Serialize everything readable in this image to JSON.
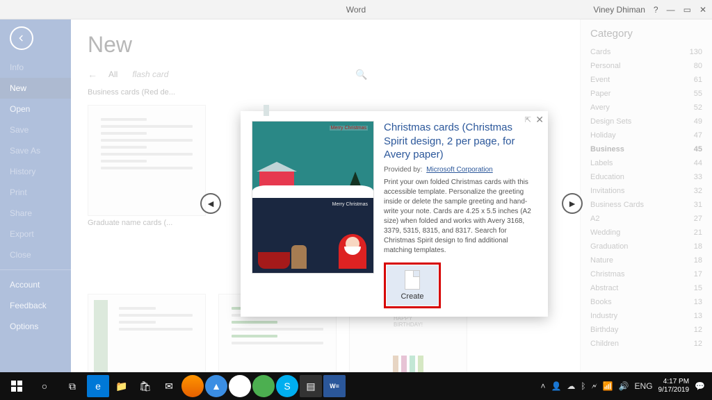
{
  "titlebar": {
    "app": "Word",
    "user": "Viney Dhiman"
  },
  "file_menu": {
    "items": [
      {
        "label": "Info",
        "state": "disabled"
      },
      {
        "label": "New",
        "state": "active"
      },
      {
        "label": "Open",
        "state": "normal"
      },
      {
        "label": "Save",
        "state": "disabled"
      },
      {
        "label": "Save As",
        "state": "disabled"
      },
      {
        "label": "History",
        "state": "disabled"
      },
      {
        "label": "Print",
        "state": "disabled"
      },
      {
        "label": "Share",
        "state": "disabled"
      },
      {
        "label": "Export",
        "state": "disabled"
      },
      {
        "label": "Close",
        "state": "disabled"
      }
    ],
    "footer": [
      {
        "label": "Account"
      },
      {
        "label": "Feedback"
      },
      {
        "label": "Options"
      }
    ]
  },
  "main": {
    "heading": "New",
    "filter_all": "All",
    "search_placeholder": "flash card",
    "templates": [
      {
        "caption": "Business cards (Red de..."
      },
      {
        "caption": "Graduate name cards (..."
      }
    ]
  },
  "categories": [
    {
      "name": "Cards",
      "count": 130
    },
    {
      "name": "Personal",
      "count": 80
    },
    {
      "name": "Event",
      "count": 61
    },
    {
      "name": "Paper",
      "count": 55
    },
    {
      "name": "Avery",
      "count": 52
    },
    {
      "name": "Design Sets",
      "count": 49
    },
    {
      "name": "Holiday",
      "count": 47
    },
    {
      "name": "Business",
      "count": 45,
      "active": true
    },
    {
      "name": "Labels",
      "count": 44
    },
    {
      "name": "Education",
      "count": 33
    },
    {
      "name": "Invitations",
      "count": 32
    },
    {
      "name": "Business Cards",
      "count": 31
    },
    {
      "name": "A2",
      "count": 27
    },
    {
      "name": "Wedding",
      "count": 21
    },
    {
      "name": "Graduation",
      "count": 18
    },
    {
      "name": "Nature",
      "count": 18
    },
    {
      "name": "Christmas",
      "count": 17
    },
    {
      "name": "Abstract",
      "count": 15
    },
    {
      "name": "Books",
      "count": 13
    },
    {
      "name": "Industry",
      "count": 13
    },
    {
      "name": "Birthday",
      "count": 12
    },
    {
      "name": "Children",
      "count": 12
    }
  ],
  "category_heading": "Category",
  "modal": {
    "title": "Christmas cards (Christmas Spirit design, 2 per page, for Avery paper)",
    "provided_label": "Provided by:",
    "provided_by": "Microsoft Corporation",
    "description": "Print your own folded Christmas cards with this accessible template. Personalize the greeting inside or delete the sample greeting and hand-write your note.  Cards are 4.25 x 5.5 inches (A2 size) when folded and works with Avery 3168, 3379, 5315, 8315, and 8317. Search for Christmas Spirit design to find additional matching templates.",
    "create_label": "Create",
    "preview_greeting": "Merry Christmas"
  },
  "taskbar": {
    "lang": "ENG",
    "time": "4:17 PM",
    "date": "9/17/2019"
  }
}
